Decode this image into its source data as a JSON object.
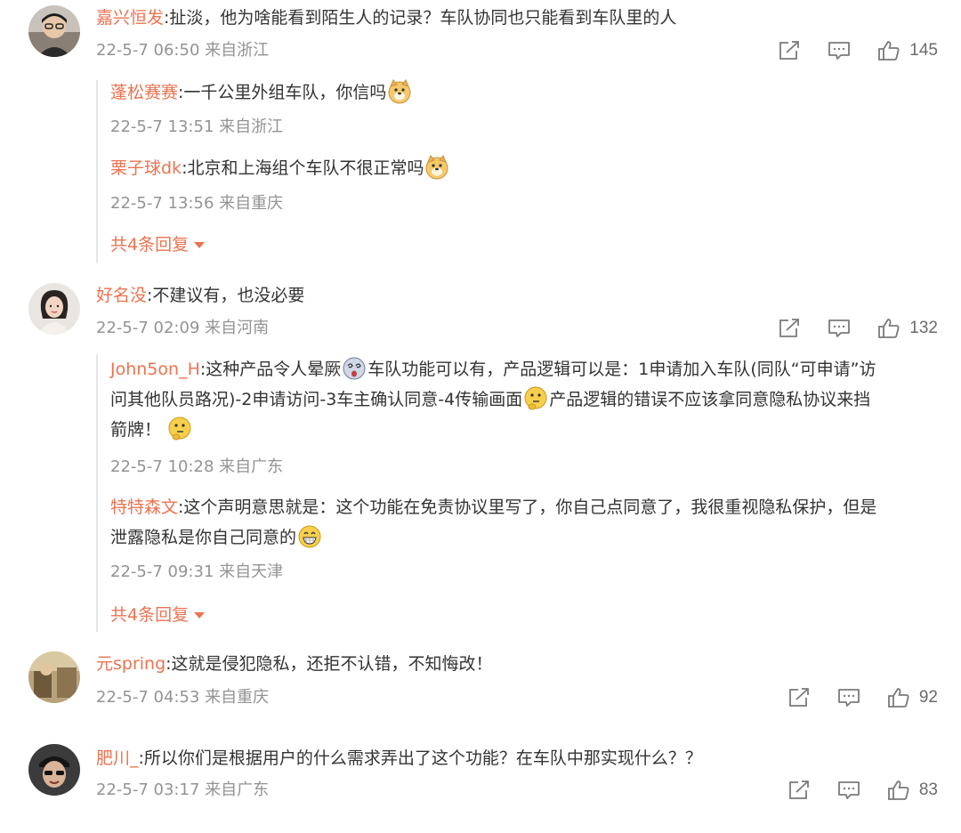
{
  "comments": [
    {
      "user": "嘉兴恒发",
      "text": ":扯淡，他为啥能看到陌生人的记录？车队协同也只能看到车队里的人",
      "time": "22-5-7 06:50 来自浙江",
      "likes": "145",
      "replies": [
        {
          "user": "蓬松赛赛",
          "text": ":一千公里外组车队，你信吗",
          "emoji": "doge-icon",
          "time": "22-5-7 13:51 来自浙江"
        },
        {
          "user": "栗子球dk",
          "text": ":北京和上海组个车队不很正常吗",
          "emoji": "doge-icon",
          "time": "22-5-7 13:56 来自重庆"
        }
      ],
      "more_label": "共4条回复"
    },
    {
      "user": "好名没",
      "text": ":不建议有，也没必要",
      "time": "22-5-7 02:09 来自河南",
      "likes": "132",
      "replies": [
        {
          "user": "John5on_H",
          "text_part1": ":这种产品令人晕厥",
          "text_part2": "车队功能可以有，产品逻辑可以是：1申请加入车队(同队“可申请”访",
          "text_line2a": "问其他队员路况)-2申请访问-3车主确认同意-4传输画面",
          "text_line2b": "产品逻辑的错误不应该拿同意隐私协议来挡",
          "text_line3": "箭牌！",
          "time": "22-5-7 10:28 来自广东"
        },
        {
          "user": "特特森文",
          "text_part1": ":这个声明意思就是：这个功能在免责协议里写了，你自己点同意了，我很重视隐私保护，但是",
          "text_line2": "泄露隐私是你自己同意的",
          "time": "22-5-7 09:31 来自天津"
        }
      ],
      "more_label": "共4条回复"
    },
    {
      "user": "元spring",
      "text": ":这就是侵犯隐私，还拒不认错，不知悔改！",
      "time": "22-5-7 04:53 来自重庆",
      "likes": "92"
    },
    {
      "user": "肥川_",
      "text": ":所以你们是根据用户的什么需求弄出了这个功能？在车队中那实现什么？？",
      "time": "22-5-7 03:17 来自广东",
      "likes": "83"
    }
  ],
  "colors": {
    "username": "#eb7350",
    "meta": "#939393",
    "text": "#333333",
    "divider": "#e6e6e6"
  },
  "icons": [
    "share-icon",
    "comment-icon",
    "like-icon",
    "doge-icon",
    "dizzy-icon",
    "thinking-icon",
    "grin-icon"
  ]
}
